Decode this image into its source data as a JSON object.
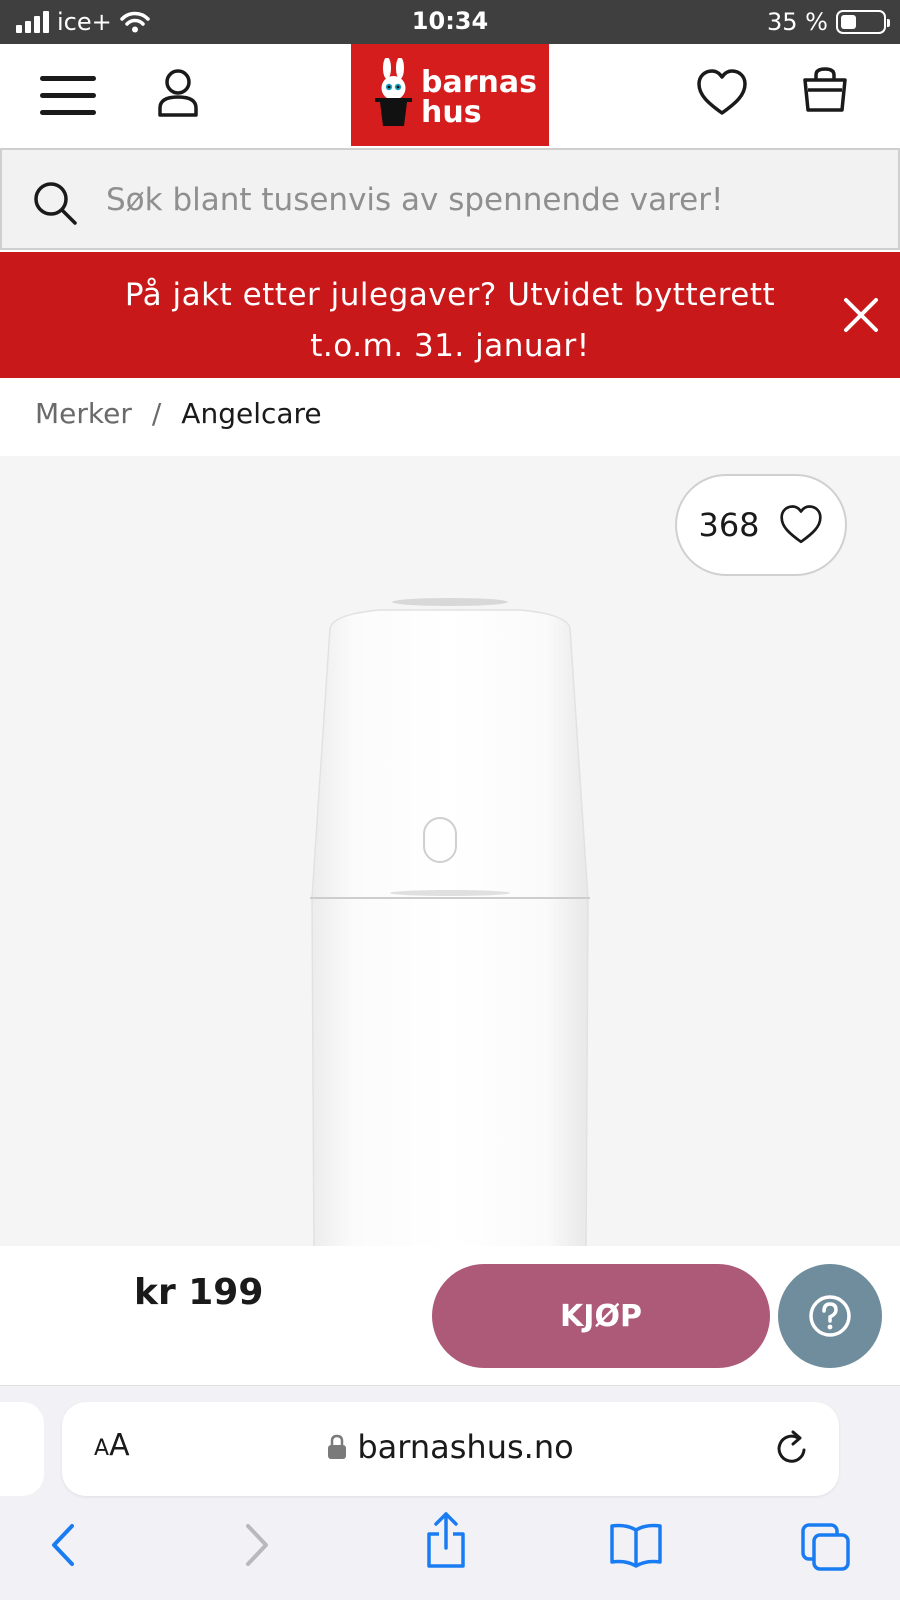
{
  "status_bar": {
    "carrier": "ice+",
    "time": "10:34",
    "battery": "35 %"
  },
  "header": {
    "logo_line1": "barnas",
    "logo_line2": "hus",
    "brand_color": "#d61d1d"
  },
  "search": {
    "placeholder": "Søk blant tusenvis av spennende varer!",
    "value": ""
  },
  "banner": {
    "line1": "På jakt etter julegaver? Utvidet bytterett",
    "line2": "t.o.m. 31. januar!",
    "color": "#c8181a"
  },
  "breadcrumb": {
    "items": [
      "Merker",
      "Angelcare"
    ],
    "separator": "/"
  },
  "product": {
    "wishlist_count": "368",
    "price": "kr 199",
    "buy_label": "KJØP",
    "buy_color": "#ad5a78",
    "help_color": "#6f8d9c"
  },
  "browser": {
    "text_size_small": "A",
    "text_size_large": "A",
    "url": "barnashus.no"
  }
}
